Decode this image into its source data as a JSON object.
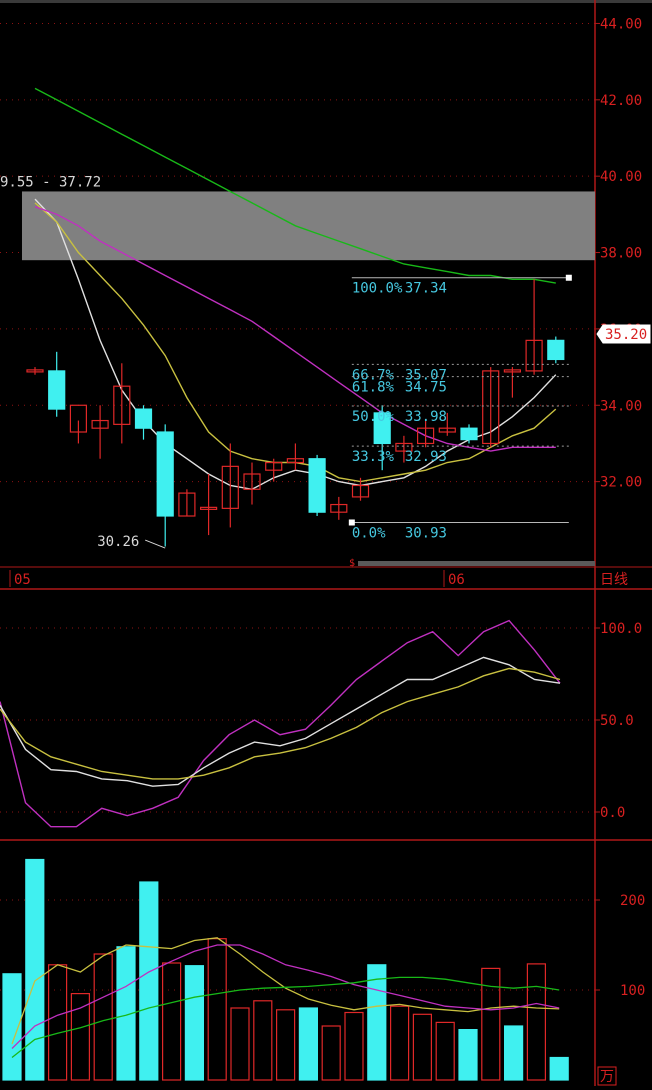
{
  "colors": {
    "background": "#000000",
    "frame": "#b01818",
    "axis_text": "#d82020",
    "up_candle": "#e02828",
    "down_candle": "#40f0f0",
    "fib_text": "#46c8e0",
    "ma_white": "#e0e0e0",
    "ma_yellow": "#c8c040",
    "ma_purple": "#c030c0",
    "ma_green": "#18b818",
    "zone_fill": "#808080",
    "label_white": "#d8d8d8"
  },
  "chart_data": [
    {
      "type": "candlestick",
      "name": "price",
      "ylim": [
        30.0,
        44.3
      ],
      "y_ticks": [
        32,
        34,
        36,
        38,
        40,
        42,
        44
      ],
      "y_tick_labels": [
        "32.00",
        "34.00",
        "36.00",
        "38.00",
        "40.00",
        "42.00",
        "44.00"
      ],
      "x_labels": [
        {
          "index": 0,
          "label": "05"
        },
        {
          "index": 19,
          "label": "06"
        }
      ],
      "period_label": "日线",
      "current_price": "35.20",
      "range_label": "9.55 - 37.72",
      "zone": [
        37.8,
        39.6
      ],
      "zone_start_index": -0.6,
      "low_annotation": {
        "text": "30.26",
        "index": 6,
        "value": 30.26
      },
      "candles": [
        {
          "o": 34.9,
          "h": 35.0,
          "l": 34.8,
          "c": 34.9
        },
        {
          "o": 34.9,
          "h": 35.4,
          "l": 33.7,
          "c": 33.9
        },
        {
          "o": 33.3,
          "h": 33.6,
          "l": 33.0,
          "c": 34.0
        },
        {
          "o": 33.4,
          "h": 34.0,
          "l": 32.6,
          "c": 33.6
        },
        {
          "o": 33.5,
          "h": 35.1,
          "l": 33.0,
          "c": 34.5
        },
        {
          "o": 33.9,
          "h": 34.0,
          "l": 33.1,
          "c": 33.4
        },
        {
          "o": 33.3,
          "h": 33.5,
          "l": 30.3,
          "c": 31.1
        },
        {
          "o": 31.1,
          "h": 31.8,
          "l": 31.1,
          "c": 31.7
        },
        {
          "o": 31.3,
          "h": 32.2,
          "l": 30.6,
          "c": 31.3
        },
        {
          "o": 31.3,
          "h": 33.0,
          "l": 30.8,
          "c": 32.4
        },
        {
          "o": 31.8,
          "h": 32.5,
          "l": 31.4,
          "c": 32.2
        },
        {
          "o": 32.3,
          "h": 32.6,
          "l": 32.0,
          "c": 32.5
        },
        {
          "o": 32.5,
          "h": 33.0,
          "l": 32.3,
          "c": 32.6
        },
        {
          "o": 32.6,
          "h": 32.7,
          "l": 31.1,
          "c": 31.2
        },
        {
          "o": 31.2,
          "h": 31.6,
          "l": 31.0,
          "c": 31.4
        },
        {
          "o": 31.6,
          "h": 32.1,
          "l": 31.5,
          "c": 31.9
        },
        {
          "o": 33.8,
          "h": 34.0,
          "l": 32.3,
          "c": 33.0
        },
        {
          "o": 32.8,
          "h": 33.2,
          "l": 32.5,
          "c": 33.0
        },
        {
          "o": 33.0,
          "h": 33.6,
          "l": 32.9,
          "c": 33.4
        },
        {
          "o": 33.3,
          "h": 33.8,
          "l": 33.2,
          "c": 33.4
        },
        {
          "o": 33.4,
          "h": 33.5,
          "l": 33.0,
          "c": 33.1
        },
        {
          "o": 33.0,
          "h": 35.0,
          "l": 32.9,
          "c": 34.9
        },
        {
          "o": 34.9,
          "h": 35.0,
          "l": 34.2,
          "c": 34.9
        },
        {
          "o": 34.9,
          "h": 37.3,
          "l": 34.8,
          "c": 35.7
        },
        {
          "o": 35.7,
          "h": 35.8,
          "l": 35.1,
          "c": 35.2
        }
      ],
      "ma_series": [
        {
          "color_key": "ma_white",
          "values": [
            39.4,
            38.8,
            37.3,
            35.7,
            34.4,
            33.6,
            33.0,
            32.6,
            32.2,
            31.9,
            31.8,
            32.1,
            32.3,
            32.2,
            32.0,
            31.9,
            32.0,
            32.1,
            32.4,
            32.8,
            33.1,
            33.3,
            33.7,
            34.2,
            34.8
          ]
        },
        {
          "color_key": "ma_yellow",
          "values": [
            39.3,
            38.8,
            38.0,
            37.4,
            36.8,
            36.1,
            35.3,
            34.2,
            33.3,
            32.8,
            32.6,
            32.5,
            32.5,
            32.4,
            32.1,
            32.0,
            32.1,
            32.2,
            32.3,
            32.5,
            32.6,
            32.9,
            33.2,
            33.4,
            33.9
          ]
        },
        {
          "color_key": "ma_purple",
          "values": [
            39.2,
            39.0,
            38.7,
            38.3,
            38.0,
            37.7,
            37.4,
            37.1,
            36.8,
            36.5,
            36.2,
            35.8,
            35.4,
            35.0,
            34.6,
            34.2,
            33.8,
            33.5,
            33.2,
            33.0,
            32.9,
            32.8,
            32.9,
            32.9,
            32.9
          ]
        },
        {
          "color_key": "ma_green",
          "values": [
            42.3,
            42.0,
            41.7,
            41.4,
            41.1,
            40.8,
            40.5,
            40.2,
            39.9,
            39.6,
            39.3,
            39.0,
            38.7,
            38.5,
            38.3,
            38.1,
            37.9,
            37.7,
            37.6,
            37.5,
            37.4,
            37.4,
            37.3,
            37.3,
            37.2
          ]
        }
      ],
      "fibonacci": {
        "start_index": 14.6,
        "end_index": 24.6,
        "levels": [
          {
            "label": "100.0%",
            "price": "37.34",
            "value": 37.34
          },
          {
            "label": "66.7%",
            "price": "35.07",
            "value": 35.07
          },
          {
            "label": "61.8%",
            "price": "34.75",
            "value": 34.75
          },
          {
            "label": "50.0%",
            "price": "33.98",
            "value": 33.98
          },
          {
            "label": "33.3%",
            "price": "32.93",
            "value": 32.93
          },
          {
            "label": "0.0%",
            "price": "30.93",
            "value": 30.93
          }
        ]
      }
    },
    {
      "type": "line",
      "name": "oscillator",
      "ylim": [
        -10,
        120
      ],
      "y_ticks": [
        0,
        50,
        100
      ],
      "y_tick_labels": [
        "0.0",
        "50.0",
        "100.0"
      ],
      "series": [
        {
          "color_key": "ma_purple",
          "values": [
            60,
            5,
            -8,
            -8,
            2,
            -2,
            2,
            8,
            28,
            42,
            50,
            42,
            45,
            58,
            72,
            82,
            92,
            98,
            85,
            98,
            104,
            88,
            70
          ]
        },
        {
          "color_key": "ma_white",
          "values": [
            58,
            34,
            23,
            22,
            18,
            17,
            14,
            15,
            24,
            32,
            38,
            36,
            40,
            48,
            56,
            64,
            72,
            72,
            78,
            84,
            80,
            72,
            70
          ]
        },
        {
          "color_key": "ma_yellow",
          "values": [
            56,
            38,
            30,
            26,
            22,
            20,
            18,
            18,
            20,
            24,
            30,
            32,
            35,
            40,
            46,
            54,
            60,
            64,
            68,
            74,
            78,
            76,
            72
          ]
        }
      ]
    },
    {
      "type": "bar",
      "name": "volume",
      "ylim": [
        0,
        265
      ],
      "y_ticks": [
        100,
        200
      ],
      "y_tick_labels": [
        "100",
        "200"
      ],
      "unit_label": "万",
      "bars": [
        {
          "v": 118,
          "up": false
        },
        {
          "v": 245,
          "up": false
        },
        {
          "v": 128,
          "up": true
        },
        {
          "v": 96,
          "up": true
        },
        {
          "v": 140,
          "up": true
        },
        {
          "v": 148,
          "up": false
        },
        {
          "v": 220,
          "up": false
        },
        {
          "v": 130,
          "up": true
        },
        {
          "v": 127,
          "up": false
        },
        {
          "v": 157,
          "up": true
        },
        {
          "v": 80,
          "up": true
        },
        {
          "v": 88,
          "up": true
        },
        {
          "v": 78,
          "up": true
        },
        {
          "v": 80,
          "up": false
        },
        {
          "v": 60,
          "up": true
        },
        {
          "v": 75,
          "up": true
        },
        {
          "v": 128,
          "up": false
        },
        {
          "v": 82,
          "up": true
        },
        {
          "v": 73,
          "up": true
        },
        {
          "v": 64,
          "up": true
        },
        {
          "v": 56,
          "up": false
        },
        {
          "v": 124,
          "up": true
        },
        {
          "v": 60,
          "up": false
        },
        {
          "v": 129,
          "up": true
        },
        {
          "v": 25,
          "up": false
        }
      ],
      "ma_series": [
        {
          "color_key": "ma_yellow",
          "values": [
            40,
            110,
            128,
            120,
            138,
            150,
            148,
            146,
            155,
            158,
            140,
            120,
            102,
            90,
            83,
            78,
            82,
            84,
            80,
            78,
            76,
            80,
            82,
            80,
            79
          ]
        },
        {
          "color_key": "ma_purple",
          "values": [
            35,
            60,
            72,
            80,
            92,
            104,
            120,
            132,
            143,
            150,
            150,
            140,
            128,
            122,
            115,
            106,
            100,
            94,
            88,
            82,
            80,
            78,
            80,
            85,
            80
          ]
        },
        {
          "color_key": "ma_green",
          "values": [
            25,
            45,
            52,
            58,
            66,
            72,
            80,
            86,
            92,
            96,
            100,
            102,
            103,
            104,
            106,
            108,
            112,
            114,
            114,
            112,
            108,
            104,
            102,
            104,
            100
          ]
        }
      ]
    }
  ]
}
